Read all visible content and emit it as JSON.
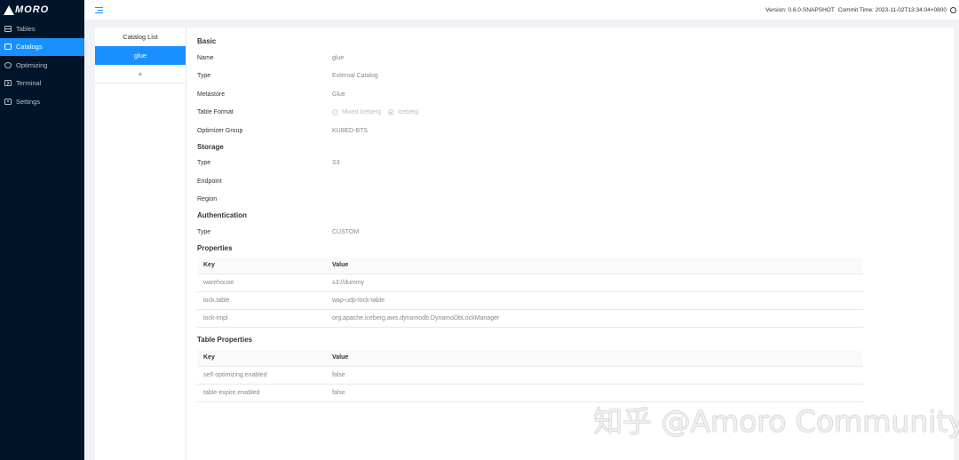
{
  "app": {
    "logo": "MORO"
  },
  "sidebar": {
    "items": [
      {
        "label": "Tables",
        "icon": "table-icon",
        "active": false
      },
      {
        "label": "Catalogs",
        "icon": "catalog-icon",
        "active": true
      },
      {
        "label": "Optimizing",
        "icon": "optimizing-icon",
        "active": false
      },
      {
        "label": "Terminal",
        "icon": "terminal-icon",
        "active": false
      },
      {
        "label": "Settings",
        "icon": "settings-icon",
        "active": false
      }
    ]
  },
  "header": {
    "version": "Version: 0.6.0-SNAPSHOT",
    "commit_time": "Commit Time: 2023-11-02T13:34:04+0800"
  },
  "catalog_list": {
    "title": "Catalog List",
    "items": [
      "glue"
    ],
    "add_label": "+"
  },
  "basic": {
    "title": "Basic",
    "name_key": "Name",
    "name_value": "glue",
    "type_key": "Type",
    "type_value": "External Catalog",
    "metastore_key": "Metastore",
    "metastore_value": "Glue",
    "table_format_key": "Table Format",
    "table_format_options": [
      "Mixed Iceberg",
      "Iceberg"
    ],
    "table_format_selected": "Iceberg",
    "optimizer_group_key": "Optimizer Group",
    "optimizer_group_value": "KUBED-BTS"
  },
  "storage": {
    "title": "Storage",
    "type_key": "Type",
    "type_value": "S3",
    "endpoint_key": "Endpoint",
    "endpoint_value": "",
    "region_key": "Region",
    "region_value": ""
  },
  "authentication": {
    "title": "Authentication",
    "type_key": "Type",
    "type_value": "CUSTOM"
  },
  "properties": {
    "title": "Properties",
    "col_key": "Key",
    "col_value": "Value",
    "rows": [
      {
        "key": "warehouse",
        "value": "s3://dummy"
      },
      {
        "key": "lock.table",
        "value": "wap-udp-lock-table"
      },
      {
        "key": "lock-impl",
        "value": "org.apache.iceberg.aws.dynamodb.DynamoDbLockManager"
      }
    ]
  },
  "table_properties": {
    "title": "Table Properties",
    "col_key": "Key",
    "col_value": "Value",
    "rows": [
      {
        "key": "self-optimizing.enabled",
        "value": "false"
      },
      {
        "key": "table-expire.enabled",
        "value": "false"
      }
    ]
  },
  "watermark": "知乎 @Amoro Community"
}
